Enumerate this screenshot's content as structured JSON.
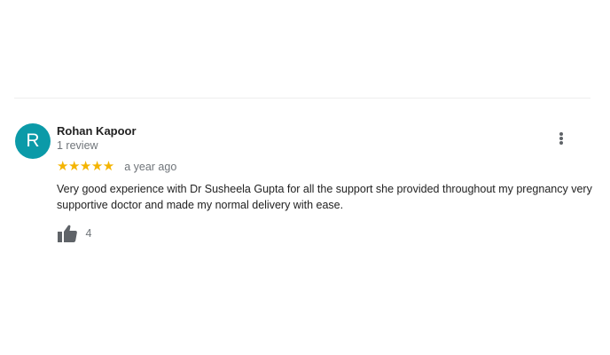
{
  "review": {
    "avatar_initial": "R",
    "avatar_color": "#0b9aa8",
    "author_name": "Rohan Kapoor",
    "review_count": "1 review",
    "rating": 5,
    "rating_max": 5,
    "stars_text": "★★★★★",
    "star_color": "#f4b400",
    "time_ago": "a year ago",
    "text": "Very good experience with Dr Susheela Gupta for all the support she provided throughout my pregnancy very supportive doctor and made my normal delivery with ease.",
    "like_icon": "thumbs-up-icon",
    "like_count": "4",
    "more_icon": "more-vert-icon"
  }
}
